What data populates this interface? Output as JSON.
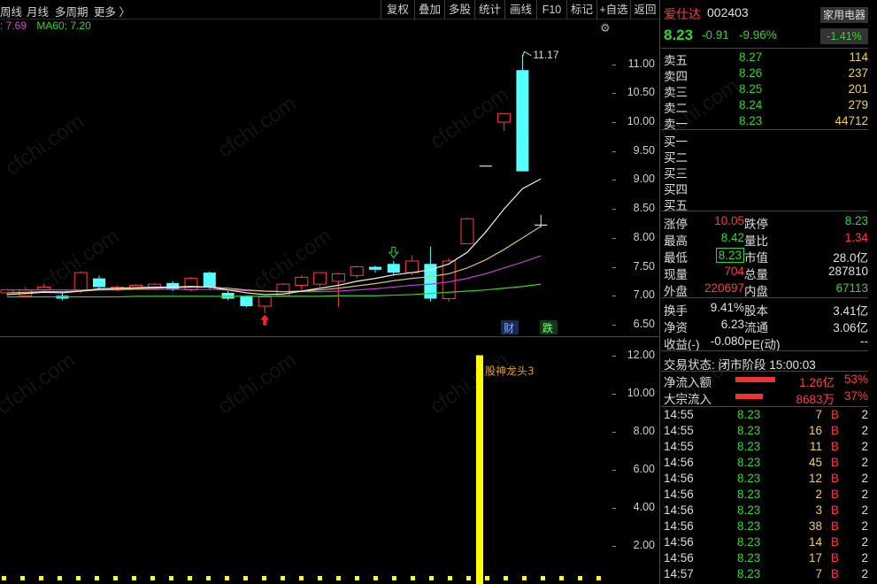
{
  "toolbar": {
    "left_items": [
      "周线",
      "月线",
      "多周期",
      "更多 〉"
    ],
    "right_items": [
      "复权",
      "叠加",
      "多股",
      "统计",
      "画线",
      "F10",
      "标记",
      "+自选",
      "返回"
    ]
  },
  "ma": {
    "ma20": "7.69",
    "ma60": "MA60: 7.20"
  },
  "chart": {
    "y_ticks": [
      "11.00",
      "10.50",
      "10.00",
      "9.50",
      "9.00",
      "8.50",
      "8.00",
      "7.50",
      "7.00",
      "6.50"
    ],
    "high_label": "11.17",
    "event_cai": "财",
    "event_die": "跌",
    "vol_ticks": [
      "12.00",
      "10.00",
      "8.00",
      "6.00",
      "4.00",
      "2.00"
    ],
    "vol_label": "股神龙头3"
  },
  "chart_data": {
    "type": "candlestick",
    "ylim": [
      6.3,
      11.5
    ],
    "candles": [
      [
        7.05,
        7.1,
        7.0,
        7.12
      ],
      [
        7.0,
        7.1,
        6.98,
        7.15
      ],
      [
        7.1,
        7.15,
        7.05,
        7.2
      ],
      [
        7.0,
        6.95,
        6.92,
        7.05
      ],
      [
        7.1,
        7.4,
        7.05,
        7.42
      ],
      [
        7.3,
        7.15,
        7.1,
        7.35
      ],
      [
        7.12,
        7.15,
        7.08,
        7.18
      ],
      [
        7.12,
        7.18,
        7.1,
        7.2
      ],
      [
        7.15,
        7.2,
        7.1,
        7.22
      ],
      [
        7.22,
        7.12,
        7.08,
        7.25
      ],
      [
        7.1,
        7.3,
        7.08,
        7.32
      ],
      [
        7.4,
        7.15,
        7.1,
        7.42
      ],
      [
        7.05,
        6.95,
        6.92,
        7.08
      ],
      [
        7.0,
        6.82,
        6.8,
        7.0
      ],
      [
        6.82,
        6.98,
        6.7,
        7.0
      ],
      [
        7.0,
        7.2,
        6.98,
        7.22
      ],
      [
        7.18,
        7.32,
        7.1,
        7.35
      ],
      [
        7.2,
        7.4,
        7.15,
        7.4
      ],
      [
        7.25,
        7.38,
        6.8,
        7.4
      ],
      [
        7.35,
        7.5,
        7.3,
        7.52
      ],
      [
        7.5,
        7.45,
        7.4,
        7.52
      ],
      [
        7.55,
        7.4,
        7.35,
        7.6
      ],
      [
        7.4,
        7.6,
        7.35,
        7.7
      ],
      [
        7.55,
        6.95,
        6.9,
        7.85
      ],
      [
        6.95,
        7.6,
        6.9,
        7.65
      ],
      [
        7.9,
        8.33,
        7.9,
        8.35
      ],
      [
        9.25,
        9.25,
        9.25,
        9.25
      ],
      [
        10.0,
        10.15,
        9.85,
        10.15
      ],
      [
        10.9,
        9.15,
        9.15,
        11.17
      ],
      [
        8.23,
        8.23,
        8.18,
        8.4
      ]
    ],
    "ma_white": [
      7.02,
      7.04,
      7.06,
      7.05,
      7.08,
      7.12,
      7.13,
      7.14,
      7.15,
      7.15,
      7.16,
      7.15,
      7.1,
      7.05,
      7.02,
      7.03,
      7.08,
      7.13,
      7.18,
      7.25,
      7.3,
      7.36,
      7.4,
      7.45,
      7.55,
      7.75,
      8.1,
      8.5,
      8.85,
      9.02
    ],
    "ma_yellow": [
      7.05,
      7.06,
      7.07,
      7.07,
      7.08,
      7.1,
      7.11,
      7.12,
      7.13,
      7.14,
      7.15,
      7.15,
      7.13,
      7.1,
      7.08,
      7.07,
      7.08,
      7.1,
      7.13,
      7.17,
      7.21,
      7.26,
      7.3,
      7.33,
      7.38,
      7.48,
      7.62,
      7.8,
      8.0,
      8.2
    ],
    "ma_purple": [
      7.1,
      7.1,
      7.1,
      7.1,
      7.1,
      7.1,
      7.1,
      7.11,
      7.11,
      7.11,
      7.11,
      7.11,
      7.1,
      7.09,
      7.08,
      7.07,
      7.07,
      7.07,
      7.08,
      7.1,
      7.12,
      7.15,
      7.18,
      7.2,
      7.24,
      7.3,
      7.38,
      7.48,
      7.58,
      7.69
    ],
    "ma_green": [
      6.98,
      6.98,
      6.98,
      6.98,
      6.98,
      6.98,
      6.98,
      6.99,
      6.99,
      6.99,
      6.99,
      6.99,
      6.99,
      6.99,
      6.99,
      6.99,
      6.99,
      6.99,
      7.0,
      7.0,
      7.0,
      7.01,
      7.02,
      7.04,
      7.06,
      7.08,
      7.1,
      7.13,
      7.16,
      7.2
    ],
    "vol_bar": {
      "index": 25,
      "value": 12.0
    },
    "markers": [
      {
        "index": 14,
        "type": "buy_arrow"
      },
      {
        "index": 21,
        "type": "sell_arrow"
      }
    ]
  },
  "stock": {
    "name": "爱仕达",
    "code": "002403",
    "sector": "家用电器",
    "sector_chg": "-1.41%",
    "price": "8.23",
    "chg": "-0.91",
    "pct": "-9.96%"
  },
  "asks": [
    {
      "label": "卖五",
      "price": "8.27",
      "vol": "114"
    },
    {
      "label": "卖四",
      "price": "8.26",
      "vol": "237"
    },
    {
      "label": "卖三",
      "price": "8.25",
      "vol": "201"
    },
    {
      "label": "卖二",
      "price": "8.24",
      "vol": "279"
    },
    {
      "label": "卖一",
      "price": "8.23",
      "vol": "44712"
    }
  ],
  "bids": [
    "买一",
    "买二",
    "买三",
    "买四",
    "买五"
  ],
  "stats": [
    {
      "l1": "涨停",
      "v1": "10.05",
      "c1": "red",
      "l2": "跌停",
      "v2": "8.23",
      "c2": "grn"
    },
    {
      "l1": "最高",
      "v1": "8.42",
      "c1": "grn",
      "l2": "量比",
      "v2": "1.34",
      "c2": "red"
    },
    {
      "l1": "最低",
      "v1": "8.23",
      "c1": "grn",
      "l2": "市值",
      "v2": "28.0亿",
      "c2": "wht"
    },
    {
      "l1": "现量",
      "v1": "704",
      "c1": "red",
      "l2": "总量",
      "v2": "287810",
      "c2": "wht"
    },
    {
      "l1": "外盘",
      "v1": "220697",
      "c1": "red",
      "l2": "内盘",
      "v2": "67113",
      "c2": "grn"
    }
  ],
  "stats2": [
    {
      "l1": "换手",
      "v1": "9.41%",
      "l2": "股本",
      "v2": "3.41亿"
    },
    {
      "l1": "净资",
      "v1": "6.23",
      "l2": "流通",
      "v2": "3.06亿"
    },
    {
      "l1": "收益(-)",
      "v1": "-0.080",
      "l2": "PE(动)",
      "v2": "--"
    }
  ],
  "status": "交易状态: 闭市阶段 15:00:03",
  "flows": [
    {
      "label": "净流入额",
      "value": "1.26亿",
      "pct": "53%",
      "fill": 0.53
    },
    {
      "label": "大宗流入",
      "value": "8683万",
      "pct": "37%",
      "fill": 0.37
    }
  ],
  "ticks": [
    {
      "t": "14:55",
      "p": "8.23",
      "v": "7",
      "s": "B",
      "n": "2"
    },
    {
      "t": "14:55",
      "p": "8.23",
      "v": "16",
      "s": "B",
      "n": "2"
    },
    {
      "t": "14:55",
      "p": "8.23",
      "v": "11",
      "s": "B",
      "n": "2"
    },
    {
      "t": "14:56",
      "p": "8.23",
      "v": "45",
      "s": "B",
      "n": "2"
    },
    {
      "t": "14:56",
      "p": "8.23",
      "v": "12",
      "s": "B",
      "n": "2"
    },
    {
      "t": "14:56",
      "p": "8.23",
      "v": "2",
      "s": "B",
      "n": "2"
    },
    {
      "t": "14:56",
      "p": "8.23",
      "v": "3",
      "s": "B",
      "n": "2"
    },
    {
      "t": "14:56",
      "p": "8.23",
      "v": "38",
      "s": "B",
      "n": "2"
    },
    {
      "t": "14:56",
      "p": "8.23",
      "v": "14",
      "s": "B",
      "n": "2"
    },
    {
      "t": "14:56",
      "p": "8.23",
      "v": "17",
      "s": "B",
      "n": "2"
    },
    {
      "t": "14:57",
      "p": "8.23",
      "v": "7",
      "s": "B",
      "n": "2"
    }
  ],
  "watermark": "cfchi.com"
}
